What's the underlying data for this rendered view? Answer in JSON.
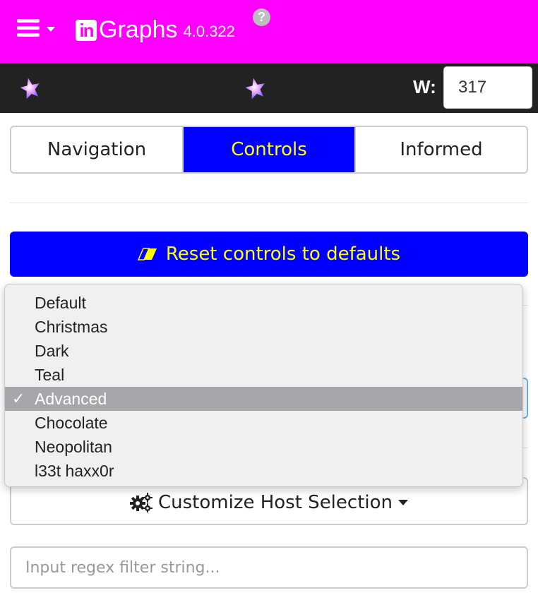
{
  "header": {
    "logo_mark": "in",
    "logo_text": "Graphs",
    "version": "4.0.322",
    "help_glyph": "?",
    "background": "#ff00ff"
  },
  "toolbar": {
    "width_label": "W:",
    "width_value": "317"
  },
  "tabs": [
    {
      "label": "Navigation",
      "active": false
    },
    {
      "label": "Controls",
      "active": true
    },
    {
      "label": "Informed",
      "active": false
    }
  ],
  "reset_button": {
    "label": "Reset controls to defaults",
    "icon": "eraser-icon"
  },
  "theme_dropdown": {
    "options": [
      "Default",
      "Christmas",
      "Dark",
      "Teal",
      "Advanced",
      "Chocolate",
      "Neopolitan",
      "l33t haxx0r"
    ],
    "selected": "Advanced",
    "check_glyph": "✓"
  },
  "customize_button": {
    "label": "Customize Host Selection",
    "icon": "cogs-icon"
  },
  "regex_filter": {
    "placeholder": "Input regex filter string..."
  },
  "colors": {
    "active_tab_bg": "#0000ff",
    "active_tab_text": "#ffff00",
    "dark_bar": "#222222"
  }
}
